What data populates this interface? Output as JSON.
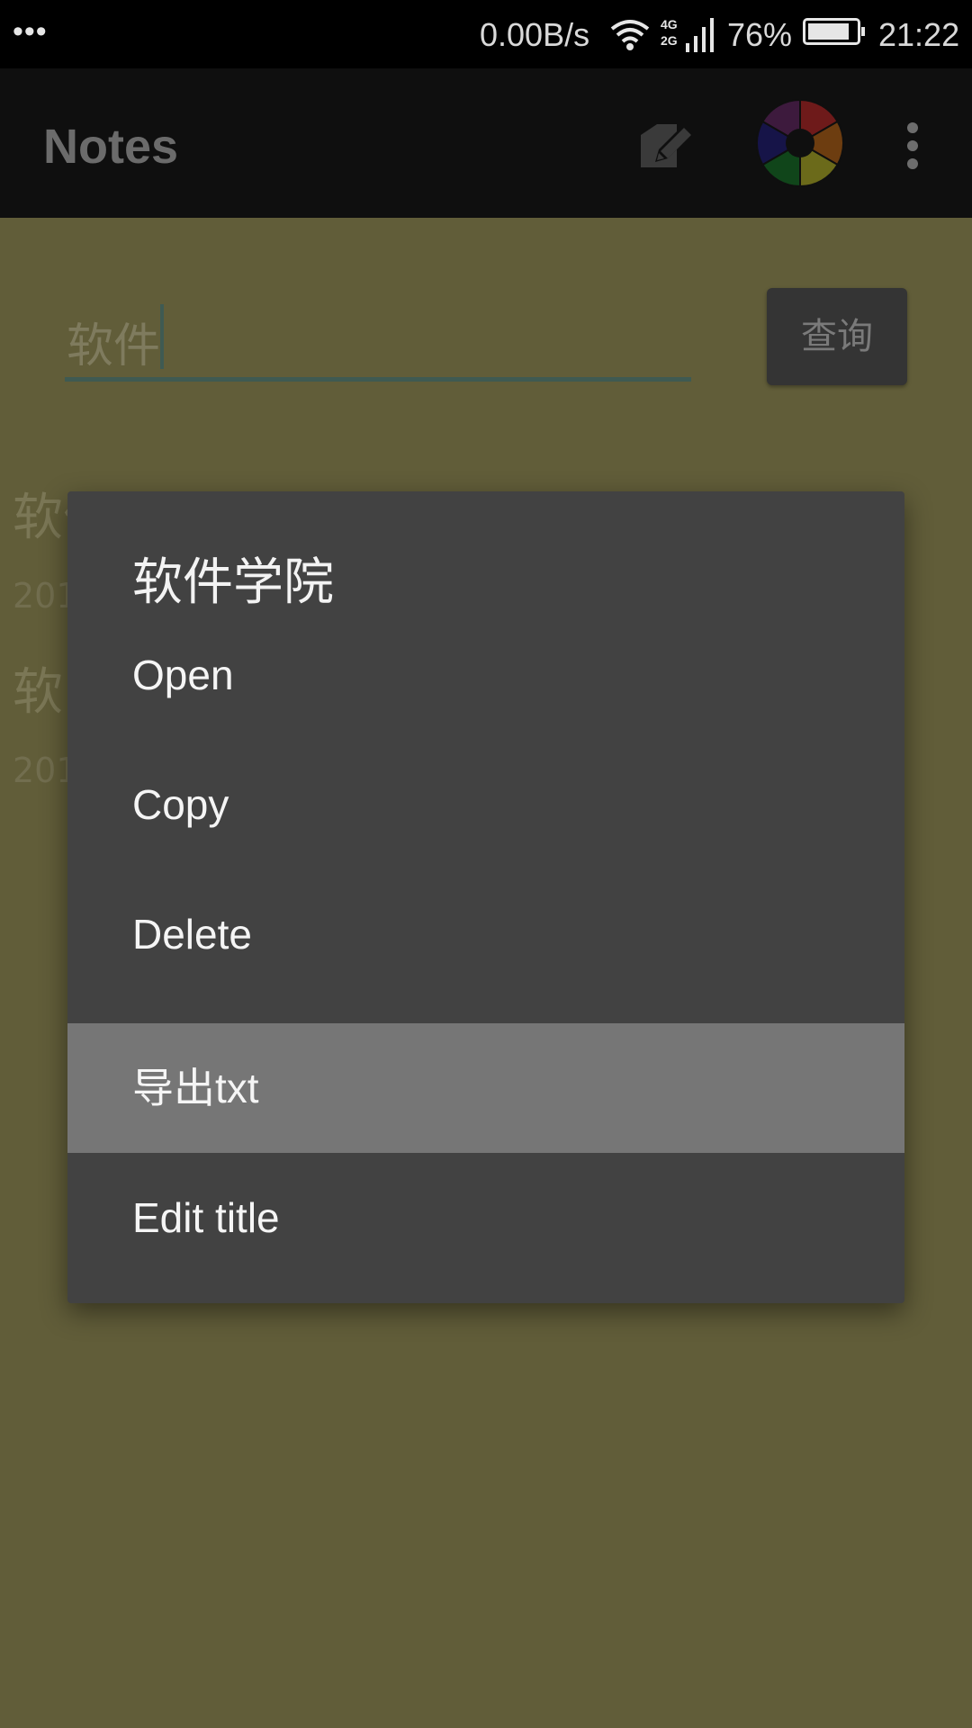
{
  "status_bar": {
    "network_speed": "0.00B/s",
    "network_labels": [
      "4G",
      "2G"
    ],
    "battery_percent": "76%",
    "time": "21:22"
  },
  "action_bar": {
    "title": "Notes",
    "icons": [
      "edit-note-icon",
      "color-palette-icon",
      "overflow-menu-icon"
    ]
  },
  "search": {
    "value": "软件",
    "button_label": "查询"
  },
  "background_list": [
    {
      "title": "软件工程",
      "date": "201"
    },
    {
      "title": "软",
      "date": "201"
    }
  ],
  "dialog": {
    "title": "软件学院",
    "items": [
      {
        "label": "Open"
      },
      {
        "label": "Copy"
      },
      {
        "label": "Delete"
      },
      {
        "label": "导出txt",
        "pressed": true
      },
      {
        "label": "Edit title"
      }
    ]
  }
}
